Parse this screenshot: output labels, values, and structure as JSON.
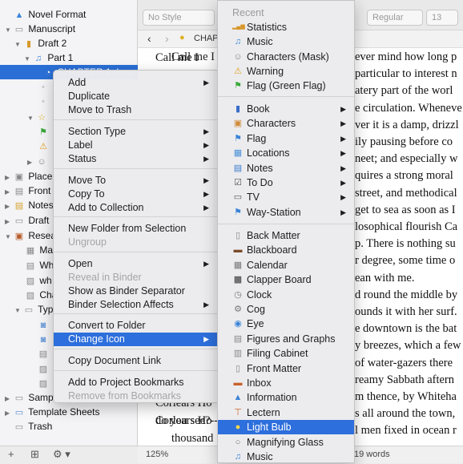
{
  "binder": {
    "items": [
      {
        "label": "Novel Format",
        "icon": "⚠",
        "twisty": ""
      },
      {
        "label": "Manuscript",
        "icon": "▭",
        "twisty": "▼"
      },
      {
        "label": "Draft 2",
        "icon": "▮",
        "twisty": "▼"
      },
      {
        "label": "Part 1",
        "icon": "♫",
        "twisty": "▼"
      },
      {
        "label": "CHAPTER 1. Loo",
        "icon": "◔",
        "twisty": ""
      },
      {
        "label": "Places",
        "icon": "▣",
        "twisty": "▶"
      },
      {
        "label": "Front",
        "icon": "▤",
        "twisty": "▶"
      },
      {
        "label": "Notes",
        "icon": "▤",
        "twisty": "▶"
      },
      {
        "label": "Draft",
        "icon": "▭",
        "twisty": "▶"
      },
      {
        "label": "Resea",
        "icon": "▣",
        "twisty": "▼"
      },
      {
        "label": "Ma",
        "icon": "▦",
        "twisty": ""
      },
      {
        "label": "Wh",
        "icon": "▤",
        "twisty": ""
      },
      {
        "label": "wh",
        "icon": "▨",
        "twisty": ""
      },
      {
        "label": "Cha",
        "icon": "▨",
        "twisty": ""
      },
      {
        "label": "Typ",
        "icon": "▭",
        "twisty": "▼"
      },
      {
        "label": "Sampl",
        "icon": "▭",
        "twisty": "▶"
      },
      {
        "label": "Template Sheets",
        "icon": "▭",
        "twisty": "▶"
      },
      {
        "label": "Trash",
        "icon": "▭",
        "twisty": ""
      }
    ],
    "footer": {
      "add": "+",
      "folder": "⊞",
      "gear": "⚙ ▾"
    }
  },
  "toolbar": {
    "style_placeholder": "No Style",
    "weight": "Regular",
    "size": "13"
  },
  "nav": {
    "back": "‹",
    "forward": "›",
    "title": "CHAP"
  },
  "editor": {
    "lines": [
      "Call me I",
      "",
      "",
      "",
      "",
      "",
      "",
      "",
      "",
      "",
      "",
      "",
      "",
      "",
      "",
      "",
      "",
      "",
      "",
      "Corlears Ho",
      "do you see?--",
      "thousand"
    ],
    "right_lines": [
      "ever mind how long p",
      "particular to interest n",
      "atery part of the worl",
      "e circulation. Wheneve",
      "ver it is a damp, drizzl",
      "ily pausing before co",
      "neet; and especially w",
      "quires a strong moral",
      "street, and methodical",
      "get to sea as soon as I",
      "losophical flourish Ca",
      "p. There is nothing su",
      "r degree, some time o",
      "ean with me.",
      "d round the middle by",
      "ounds it with her surf.",
      "e downtown is the bat",
      "y breezes, which a few",
      "of water-gazers there",
      "reamy Sabbath aftern",
      "m thence, by Whiteha",
      "s all around the town,",
      "l men fixed in ocean r"
    ]
  },
  "status": {
    "zoom": "125%",
    "words": "19 words"
  },
  "context_menu": {
    "items": [
      {
        "label": "Add",
        "arrow": true
      },
      {
        "label": "Duplicate"
      },
      {
        "label": "Move to Trash"
      },
      {
        "label": "Section Type",
        "arrow": true
      },
      {
        "label": "Label",
        "arrow": true
      },
      {
        "label": "Status",
        "arrow": true
      },
      {
        "label": "Move To",
        "arrow": true
      },
      {
        "label": "Copy To",
        "arrow": true
      },
      {
        "label": "Add to Collection",
        "arrow": true
      },
      {
        "label": "New Folder from Selection"
      },
      {
        "label": "Ungroup",
        "disabled": true
      },
      {
        "label": "Open",
        "arrow": true
      },
      {
        "label": "Reveal in Binder",
        "disabled": true
      },
      {
        "label": "Show as Binder Separator"
      },
      {
        "label": "Binder Selection Affects",
        "arrow": true
      },
      {
        "label": "Convert to Folder"
      },
      {
        "label": "Change Icon",
        "arrow": true,
        "highlight": true
      },
      {
        "label": "Copy Document Link"
      },
      {
        "label": "Add to Project Bookmarks"
      },
      {
        "label": "Remove from Bookmarks",
        "disabled": true
      }
    ]
  },
  "icon_submenu": {
    "recent_header": "Recent",
    "recent": [
      {
        "label": "Statistics",
        "icon": "▂▄▆"
      },
      {
        "label": "Music",
        "icon": "♫"
      },
      {
        "label": "Characters (Mask)",
        "icon": "☺"
      },
      {
        "label": "Warning",
        "icon": "⚠"
      },
      {
        "label": "Flag (Green Flag)",
        "icon": "⚑"
      }
    ],
    "groups": [
      {
        "label": "Book",
        "icon": "▮"
      },
      {
        "label": "Characters",
        "icon": "▣"
      },
      {
        "label": "Flag",
        "icon": "⚑"
      },
      {
        "label": "Locations",
        "icon": "▦"
      },
      {
        "label": "Notes",
        "icon": "▤"
      },
      {
        "label": "To Do",
        "icon": "☑"
      },
      {
        "label": "TV",
        "icon": "▭"
      },
      {
        "label": "Way-Station",
        "icon": "⚑"
      }
    ],
    "icons": [
      {
        "label": "Back Matter",
        "icon": "▯"
      },
      {
        "label": "Blackboard",
        "icon": "▬"
      },
      {
        "label": "Calendar",
        "icon": "▦"
      },
      {
        "label": "Clapper Board",
        "icon": "▩"
      },
      {
        "label": "Clock",
        "icon": "◷"
      },
      {
        "label": "Cog",
        "icon": "⚙"
      },
      {
        "label": "Eye",
        "icon": "◉"
      },
      {
        "label": "Figures and Graphs",
        "icon": "▤"
      },
      {
        "label": "Filing Cabinet",
        "icon": "▥"
      },
      {
        "label": "Front Matter",
        "icon": "▯"
      },
      {
        "label": "Inbox",
        "icon": "▬"
      },
      {
        "label": "Information",
        "icon": "▲"
      },
      {
        "label": "Lectern",
        "icon": "⊤"
      },
      {
        "label": "Light Bulb",
        "icon": "●",
        "highlight": true
      },
      {
        "label": "Magnifying Glass",
        "icon": "○"
      },
      {
        "label": "Music",
        "icon": "♫"
      }
    ]
  },
  "colors": {
    "accent": "#2d6fdc",
    "selection": "#2a6fd6",
    "warning": "#f2b518"
  }
}
